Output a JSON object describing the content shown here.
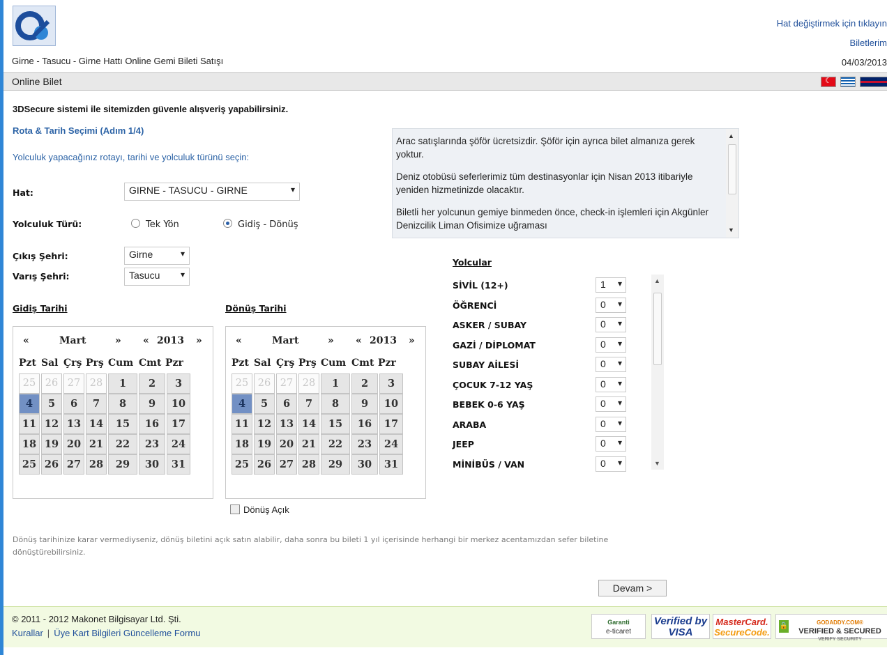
{
  "header": {
    "logo_text": "ak",
    "route_title": "Girne - Tasucu - Girne Hattı Online Gemi Bileti Satışı",
    "change_line_link": "Hat değiştirmek için tıklayın",
    "tickets_link": "Biletlerim",
    "date": "04/03/2013"
  },
  "bar": {
    "title": "Online Bilet",
    "flags": [
      "turkey-flag-icon",
      "greece-flag-icon",
      "uk-flag-icon"
    ]
  },
  "secure_notice": "3DSecure sistemi ile sitemizden güvenle alışveriş yapabilirsiniz.",
  "step_title": "Rota & Tarih Seçimi (Adım 1/4)",
  "intro": "Yolculuk yapacağınız rotayı, tarihi ve yolculuk türünü seçin:",
  "form": {
    "hat_label": "Hat:",
    "hat_value": "GIRNE - TASUCU - GIRNE",
    "trip_type_label": "Yolculuk Türü:",
    "trip_one_way": "Tek Yön",
    "trip_round": "Gidiş - Dönüş",
    "trip_selected": "Gidiş - Dönüş",
    "departure_label": "Çıkış Şehri:",
    "departure_value": "Girne",
    "arrival_label": "Varış Şehri:",
    "arrival_value": "Tasucu"
  },
  "info_box": {
    "paragraphs": [
      "Arac satışlarında şöför ücretsizdir. Şöför için ayrıca bilet almanıza gerek yoktur.",
      "Deniz otobüsü seferlerimiz tüm destinasyonlar için Nisan 2013 itibariyle yeniden hizmetinizde olacaktır.",
      "Biletli her yolcunun gemiye binmeden önce, check-in işlemleri için Akgünler Denizcilik Liman Ofisimize uğraması"
    ]
  },
  "calendars": {
    "go_title": "Gidiş Tarihi",
    "return_title": "Dönüş Tarihi",
    "prev_month": "«",
    "month": "Mart",
    "next_month": "»",
    "prev_year": "«",
    "year": "2013",
    "next_year": "»",
    "weekdays": [
      "Pzt",
      "Sal",
      "Çrş",
      "Prş",
      "Cum",
      "Cmt",
      "Pzr"
    ],
    "prev_days": [
      "25",
      "26",
      "27",
      "28"
    ],
    "days": [
      "1",
      "2",
      "3",
      "4",
      "5",
      "6",
      "7",
      "8",
      "9",
      "10",
      "11",
      "12",
      "13",
      "14",
      "15",
      "16",
      "17",
      "18",
      "19",
      "20",
      "21",
      "22",
      "23",
      "24",
      "25",
      "26",
      "27",
      "28",
      "29",
      "30",
      "31"
    ],
    "selected_day": "4",
    "return_open_label": "Dönüş Açık"
  },
  "passengers": {
    "title": "Yolcular",
    "rows": [
      {
        "label": "SİVİL (12+)",
        "value": "1"
      },
      {
        "label": "ÖĞRENCİ",
        "value": "0"
      },
      {
        "label": "ASKER / SUBAY",
        "value": "0"
      },
      {
        "label": "GAZİ / DİPLOMAT",
        "value": "0"
      },
      {
        "label": "SUBAY AİLESİ",
        "value": "0"
      },
      {
        "label": "ÇOCUK 7-12 YAŞ",
        "value": "0"
      },
      {
        "label": "BEBEK 0-6 YAŞ",
        "value": "0"
      },
      {
        "label": "ARABA",
        "value": "0"
      },
      {
        "label": "JEEP",
        "value": "0"
      },
      {
        "label": "MİNİBÜS / VAN",
        "value": "0"
      }
    ]
  },
  "note": "Dönüş tarihinize karar vermediyseniz, dönüş biletini açık satın alabilir, daha sonra bu bileti 1 yıl içerisinde herhangi bir merkez acentamızdan sefer biletine dönüştürebilirsiniz.",
  "continue_button": "Devam >",
  "footer": {
    "copyright": "© 2011 - 2012 Makonet Bilgisayar Ltd. Şti.",
    "link_rules": "Kurallar",
    "link_separator": "|",
    "link_member": "Üye Kart Bilgileri Güncelleme Formu",
    "badges": {
      "garanti_top": "Garanti",
      "garanti_bottom": "e-ticaret",
      "visa_top": "Verified by",
      "visa_bottom": "VISA",
      "mc_top": "MasterCard.",
      "mc_bottom": "SecureCode.",
      "godaddy_top": "GODADDY.COM®",
      "godaddy_mid": "VERIFIED & SECURED",
      "godaddy_bottom": "VERIFY SECURITY"
    }
  }
}
